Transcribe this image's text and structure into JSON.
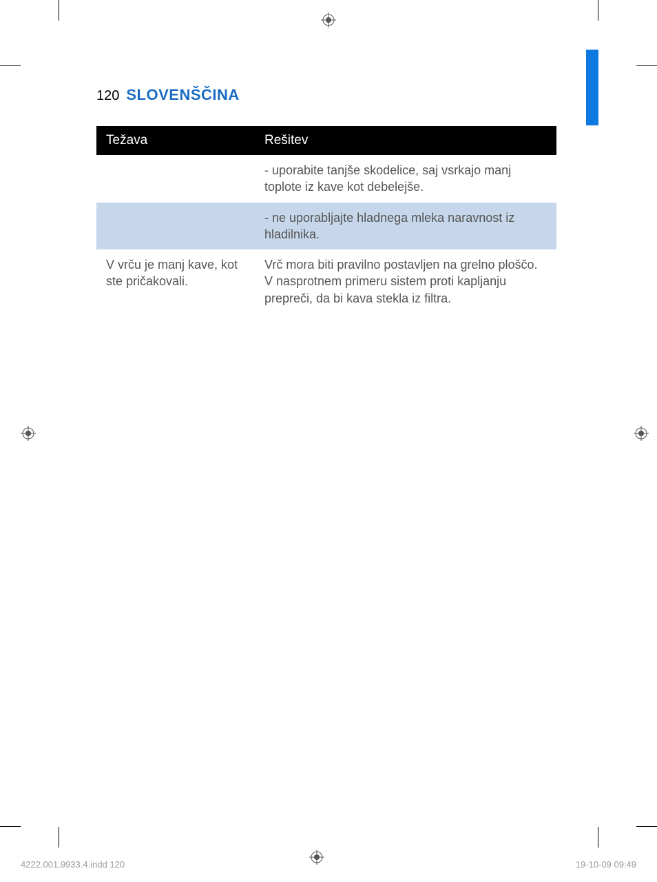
{
  "header": {
    "page_number": "120",
    "title": "SLOVENŠČINA"
  },
  "table": {
    "headers": {
      "problem": "Težava",
      "solution": "Rešitev"
    },
    "rows": [
      {
        "problem": "",
        "solution": "- uporabite tanjše skodelice, saj vsrkajo manj toplote iz kave kot debelejše."
      },
      {
        "problem": "",
        "solution": "- ne uporabljajte hladnega mleka naravnost iz hladilnika."
      },
      {
        "problem": "V vrču je manj kave, kot ste pričakovali.",
        "solution": "Vrč mora biti pravilno postavljen na grelno ploščo. V nasprotnem primeru sistem proti kapljanju prepreči, da bi kava stekla iz filtra."
      }
    ]
  },
  "footer": {
    "left": "4222.001.9933.4.indd   120",
    "right": "19-10-09   09:49"
  }
}
